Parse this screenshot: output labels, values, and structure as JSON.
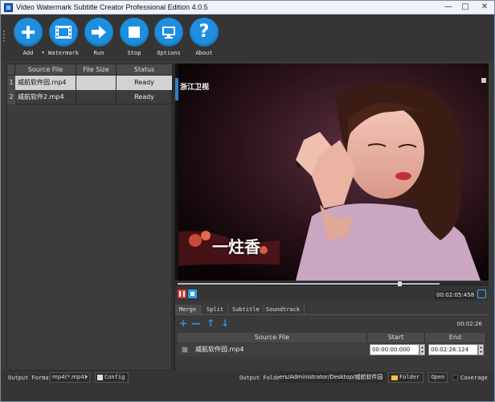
{
  "window": {
    "title": "Video Watermark Subtitle Creator Professional Edition 4.0.5",
    "controls": [
      "—",
      "□",
      "✕"
    ]
  },
  "toolbar": {
    "buttons": [
      {
        "label": "Add",
        "icon": "plus-icon"
      },
      {
        "label": "Watermark",
        "icon": "film-icon"
      },
      {
        "label": "Run",
        "icon": "arrow-right-icon"
      },
      {
        "label": "Stop",
        "icon": "stop-square-icon"
      },
      {
        "label": "Options",
        "icon": "monitor-icon"
      },
      {
        "label": "About",
        "icon": "question-icon"
      }
    ],
    "add_dropdown": "▾"
  },
  "file_table": {
    "headers": [
      "Source File",
      "File Size",
      "Status"
    ],
    "rows": [
      {
        "num": "1",
        "file": "威航软件园.mp4",
        "size": "",
        "status": "Ready"
      },
      {
        "num": "2",
        "file": "威航软件2.mp4",
        "size": "",
        "status": "Ready"
      }
    ]
  },
  "preview": {
    "channel_logo": "浙江卫视",
    "caption": "一炷香"
  },
  "player": {
    "timecode": "00:02:05:458",
    "progress_fraction": 0.84
  },
  "tabs": [
    "Merge",
    "Split",
    "Subtitle",
    "Soundtrack"
  ],
  "merge": {
    "total_time": "00:02:26",
    "headers": [
      "Source File",
      "Start",
      "End"
    ],
    "row": {
      "file": "威航软件园.mp4",
      "start": "00:00:00:000",
      "end": "00:02:26:124"
    },
    "tool_icons": [
      "add-icon",
      "remove-icon",
      "move-up-icon",
      "move-down-icon"
    ]
  },
  "bottom": {
    "output_format_label": "Output Format",
    "output_format_value": "mp4(*.mp4)",
    "config_label": "Config",
    "output_folder_label": "Output Folder",
    "output_folder_path": "ers/Administrator/Desktop/威航软件园",
    "folder_label": "Folder",
    "open_label": "Open",
    "coverage_label": "Coverage"
  },
  "colors": {
    "accent": "#1e8fe0",
    "background": "#3a3a3a",
    "selected_row": "#d2d2d2"
  }
}
